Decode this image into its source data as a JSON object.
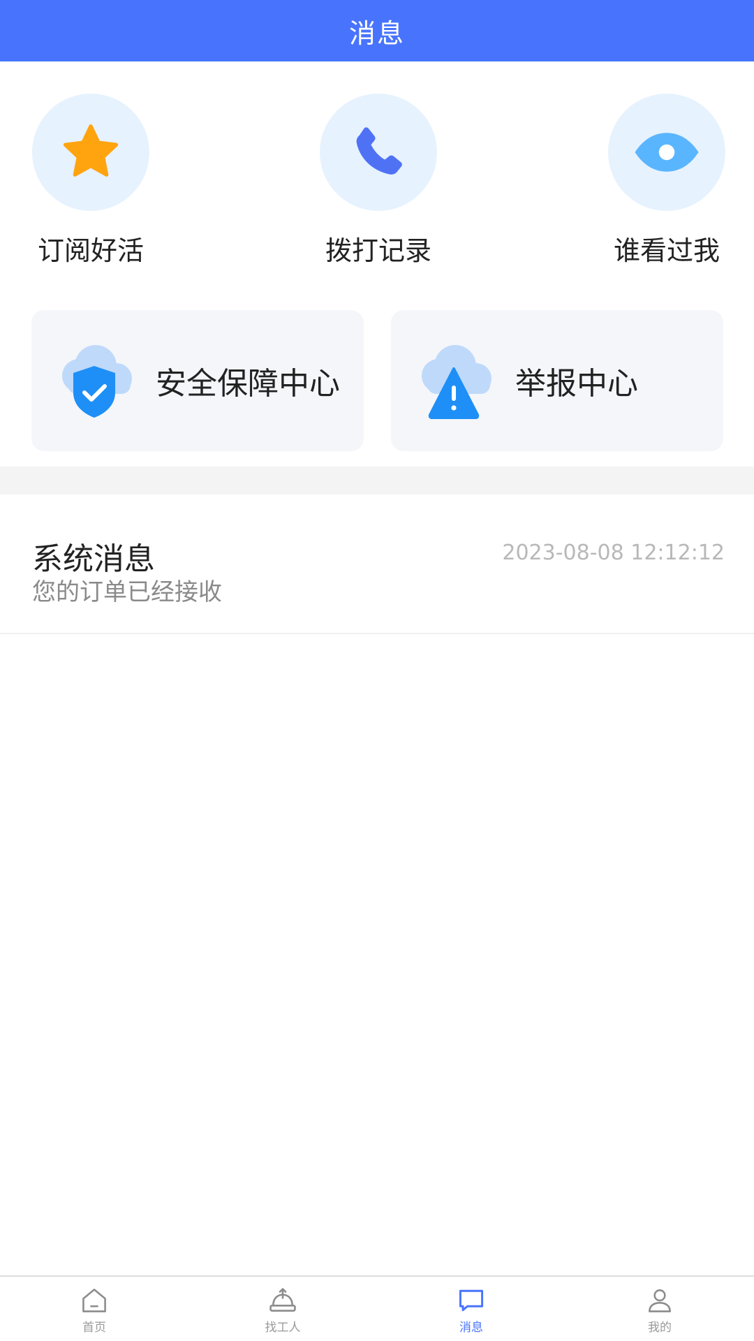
{
  "header": {
    "title": "消息"
  },
  "colors": {
    "accent": "#4874FD",
    "star": "#FFA30F",
    "phone": "#4F72F5",
    "eye": "#5AB5FF",
    "shield": "#1E8FF6",
    "circle_bg": "#E6F2FE",
    "card_bg": "#F4F6FA"
  },
  "quick_actions": [
    {
      "label": "订阅好活",
      "icon": "star-icon"
    },
    {
      "label": "拨打记录",
      "icon": "phone-icon"
    },
    {
      "label": "谁看过我",
      "icon": "eye-icon"
    }
  ],
  "cards": [
    {
      "label": "安全保障中心",
      "icon": "shield-check-icon"
    },
    {
      "label": "举报中心",
      "icon": "warning-icon"
    }
  ],
  "messages": [
    {
      "title": "系统消息",
      "subtitle": "您的订单已经接收",
      "time": "2023-08-08 12:12:12"
    }
  ],
  "tabbar": {
    "items": [
      {
        "label": "首页",
        "icon": "home-icon"
      },
      {
        "label": "找工人",
        "icon": "hard-hat-icon"
      },
      {
        "label": "消息",
        "icon": "message-icon",
        "active": true
      },
      {
        "label": "我的",
        "icon": "user-icon"
      }
    ]
  }
}
